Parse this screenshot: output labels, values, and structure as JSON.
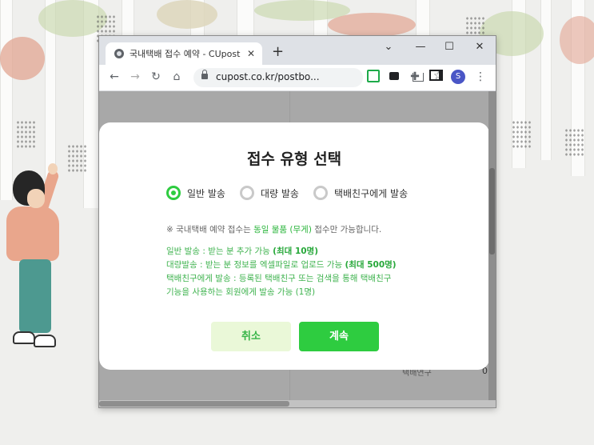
{
  "browser": {
    "tab_title": "국내택배 접수 예약 - CUpost",
    "new_tab": "+",
    "url": "cupost.co.kr/postbo...",
    "avatar_letter": "S",
    "controls": {
      "menu": "⌄",
      "minimize": "—",
      "maximize": "☐",
      "close": "✕"
    },
    "icons": [
      "back-icon",
      "forward-icon",
      "reload-icon",
      "home-icon",
      "lock-icon",
      "share-icon",
      "star-icon",
      "extension-green-icon",
      "extension-dark-icon",
      "puzzle-icon",
      "sidebar-icon",
      "more-icon"
    ]
  },
  "background_page": {
    "peek_text": "택배연구",
    "peek_text_2": "0"
  },
  "modal": {
    "title": "접수 유형 선택",
    "options": [
      {
        "label": "일반 발송",
        "selected": true
      },
      {
        "label": "대량 발송",
        "selected": false
      },
      {
        "label": "택배친구에게 발송",
        "selected": false
      }
    ],
    "notice_prefix": "※ 국내택배 예약 접수는 ",
    "notice_highlight": "동일 물품 (무게)",
    "notice_suffix": " 접수만 가능합니다.",
    "descriptions": [
      {
        "text": "일반 발송 : 받는 분 추가 가능 ",
        "bold": "(최대 10명)"
      },
      {
        "text": "대량발송 : 받는 분 정보를 엑셀파일로 업로드 가능 ",
        "bold": "(최대 500명)"
      },
      {
        "text": "택배친구에게 발송 : 등록된 택배친구 또는 검색을 통해 택배친구",
        "bold": ""
      },
      {
        "text": "기능을 사용하는 회원에게 발송 가능 (1명)",
        "bold": ""
      }
    ],
    "cancel_label": "취소",
    "confirm_label": "계속"
  },
  "colors": {
    "accent": "#2ecc40",
    "cancel_bg": "#eaf8d8",
    "desc_text": "#3fb34f"
  }
}
